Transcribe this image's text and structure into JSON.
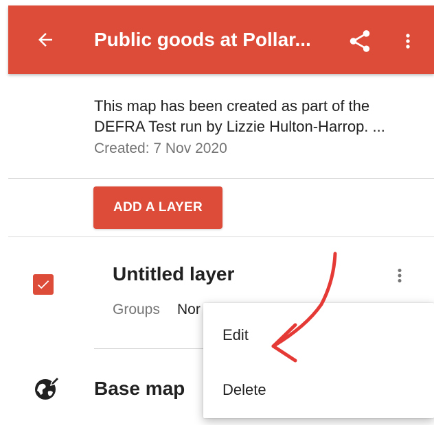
{
  "appbar": {
    "title": "Public goods at Pollar...",
    "back_icon": "arrow-back-icon",
    "share_icon": "share-icon",
    "more_icon": "more-vert-icon",
    "color": "#dd4b39"
  },
  "map_info": {
    "description_line1": "This map has been created as part of the",
    "description_line2": "DEFRA Test run by Lizzie Hulton-Harrop. ...",
    "created": "Created: 7 Nov 2020"
  },
  "actions": {
    "add_layer_label": "ADD A LAYER"
  },
  "layer": {
    "checked": true,
    "title": "Untitled layer",
    "groups_label": "Groups",
    "groups_value": "Nor"
  },
  "base_map": {
    "label": "Base map",
    "icon": "globe-edit-icon"
  },
  "context_menu": {
    "items": [
      "Edit",
      "Delete"
    ]
  },
  "annotation": {
    "color": "#e53935",
    "icon": "hand-drawn-arrow"
  }
}
